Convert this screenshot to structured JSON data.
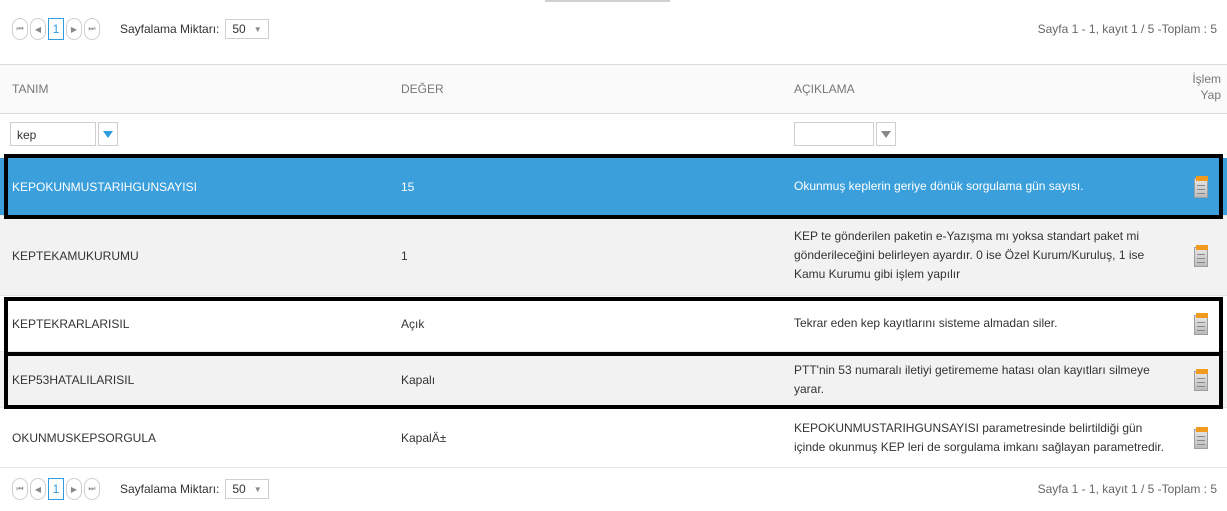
{
  "pager": {
    "first": "⏮",
    "prev": "◀",
    "page": "1",
    "next": "▶",
    "last": "⏭",
    "page_size_label": "Sayfalama Miktarı:",
    "page_size_value": "50",
    "info": "Sayfa 1 - 1, kayıt 1 / 5 -Toplam : 5"
  },
  "columns": {
    "tanim": "TANIM",
    "deger": "DEĞER",
    "aciklama": "AÇIKLAMA",
    "islem_line1": "İşlem",
    "islem_line2": "Yap"
  },
  "filter": {
    "tanim_value": "kep",
    "aciklama_value": ""
  },
  "rows": [
    {
      "tanim": "KEPOKUNMUSTARIHGUNSAYISI",
      "deger": "15",
      "aciklama": "Okunmuş keplerin geriye dönük sorgulama gün sayısı."
    },
    {
      "tanim": "KEPTEKAMUKURUMU",
      "deger": "1",
      "aciklama": "KEP te gönderilen paketin e-Yazışma mı yoksa standart paket mi gönderileceğini belirleyen ayardır. 0 ise Özel Kurum/Kuruluş, 1 ise Kamu Kurumu gibi işlem yapılır"
    },
    {
      "tanim": "KEPTEKRARLARISIL",
      "deger": "Açık",
      "aciklama": "Tekrar eden kep kayıtlarını sisteme almadan siler."
    },
    {
      "tanim": "KEP53HATALILARISIL",
      "deger": "Kapalı",
      "aciklama": "PTT'nin 53 numaralı iletiyi getirememe hatası olan kayıtları silmeye yarar."
    },
    {
      "tanim": "OKUNMUSKEPSORGULA",
      "deger": "KapalÄ±",
      "aciklama": "KEPOKUNMUSTARIHGUNSAYISI parametresinde belirtildiği gün içinde okunmuş KEP leri de sorgulama imkanı sağlayan parametredir."
    }
  ],
  "colors": {
    "selected_row": "#3a9fdb",
    "accent": "#2d9de0",
    "highlight_outline": "#000000"
  }
}
